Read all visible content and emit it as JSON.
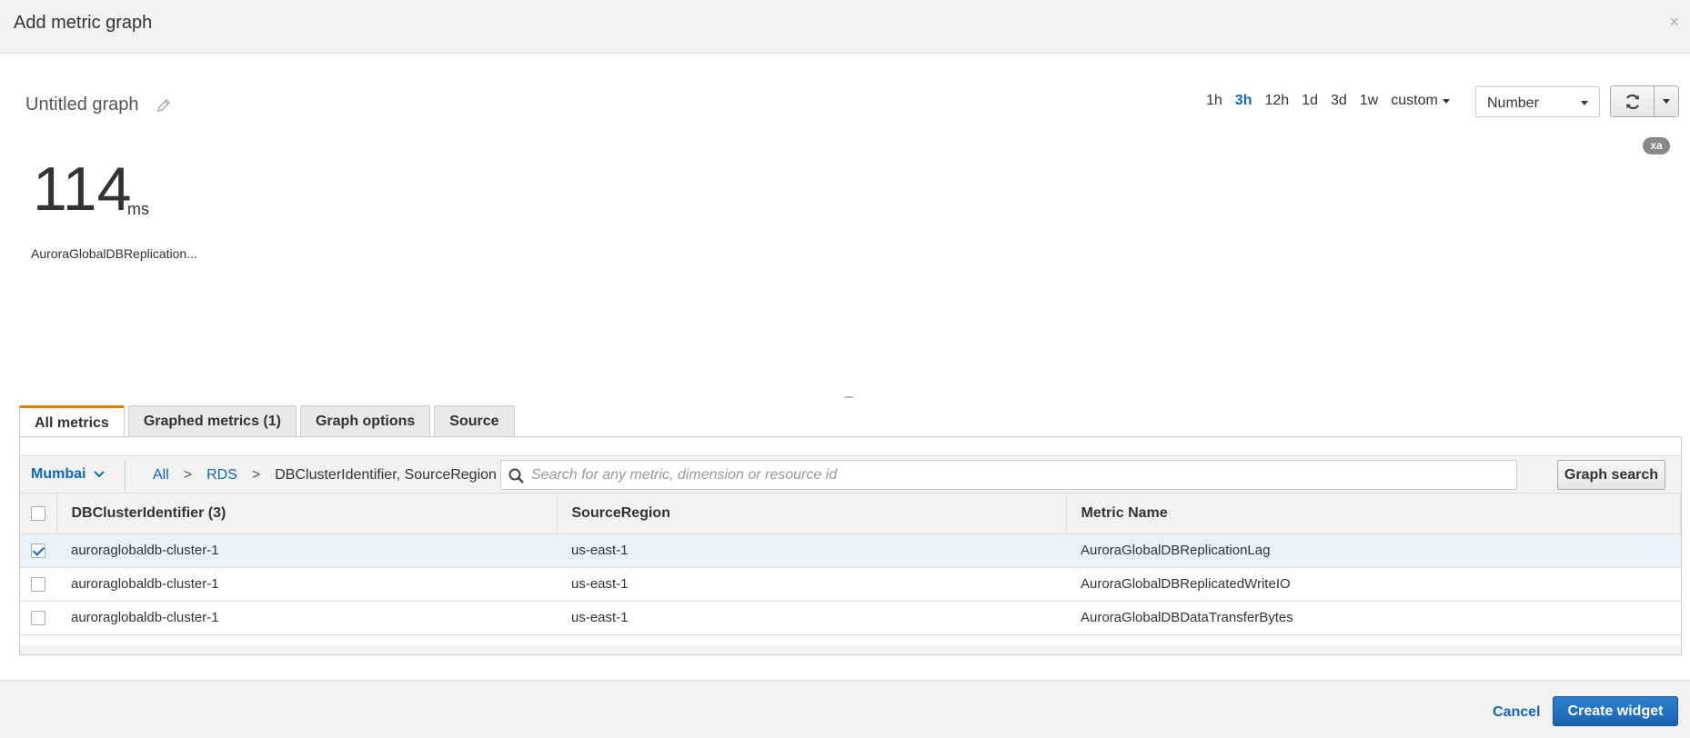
{
  "dialog": {
    "title": "Add metric graph",
    "close_label": "×"
  },
  "graph": {
    "title": "Untitled graph",
    "value": "114",
    "unit": "ms",
    "metric_label": "AuroraGlobalDBReplication..."
  },
  "time_range": {
    "options": [
      "1h",
      "3h",
      "12h",
      "1d",
      "3d",
      "1w"
    ],
    "active": "3h",
    "custom_label": "custom"
  },
  "view_select": {
    "value": "Number"
  },
  "badge": {
    "text": "xa"
  },
  "resize_handle": "---",
  "tabs": [
    {
      "label": "All metrics",
      "active": true
    },
    {
      "label": "Graphed metrics (1)",
      "active": false
    },
    {
      "label": "Graph options",
      "active": false
    },
    {
      "label": "Source",
      "active": false
    }
  ],
  "browser": {
    "region": "Mumbai",
    "breadcrumb": {
      "all": "All",
      "namespace": "RDS",
      "current": "DBClusterIdentifier, SourceRegion",
      "separator": ">"
    },
    "search_placeholder": "Search for any metric, dimension or resource id",
    "search_button": "Graph search"
  },
  "table": {
    "columns": [
      "DBClusterIdentifier  (3)",
      "SourceRegion",
      "Metric Name"
    ],
    "rows": [
      {
        "checked": true,
        "cluster": "auroraglobaldb-cluster-1",
        "region": "us-east-1",
        "metric": "AuroraGlobalDBReplicationLag"
      },
      {
        "checked": false,
        "cluster": "auroraglobaldb-cluster-1",
        "region": "us-east-1",
        "metric": "AuroraGlobalDBReplicatedWriteIO"
      },
      {
        "checked": false,
        "cluster": "auroraglobaldb-cluster-1",
        "region": "us-east-1",
        "metric": "AuroraGlobalDBDataTransferBytes"
      }
    ]
  },
  "footer": {
    "cancel_label": "Cancel",
    "create_label": "Create widget"
  },
  "colors": {
    "accent_blue": "#1166bb",
    "active_tab_orange": "#e07b00",
    "primary_button": "#1a65b3"
  }
}
